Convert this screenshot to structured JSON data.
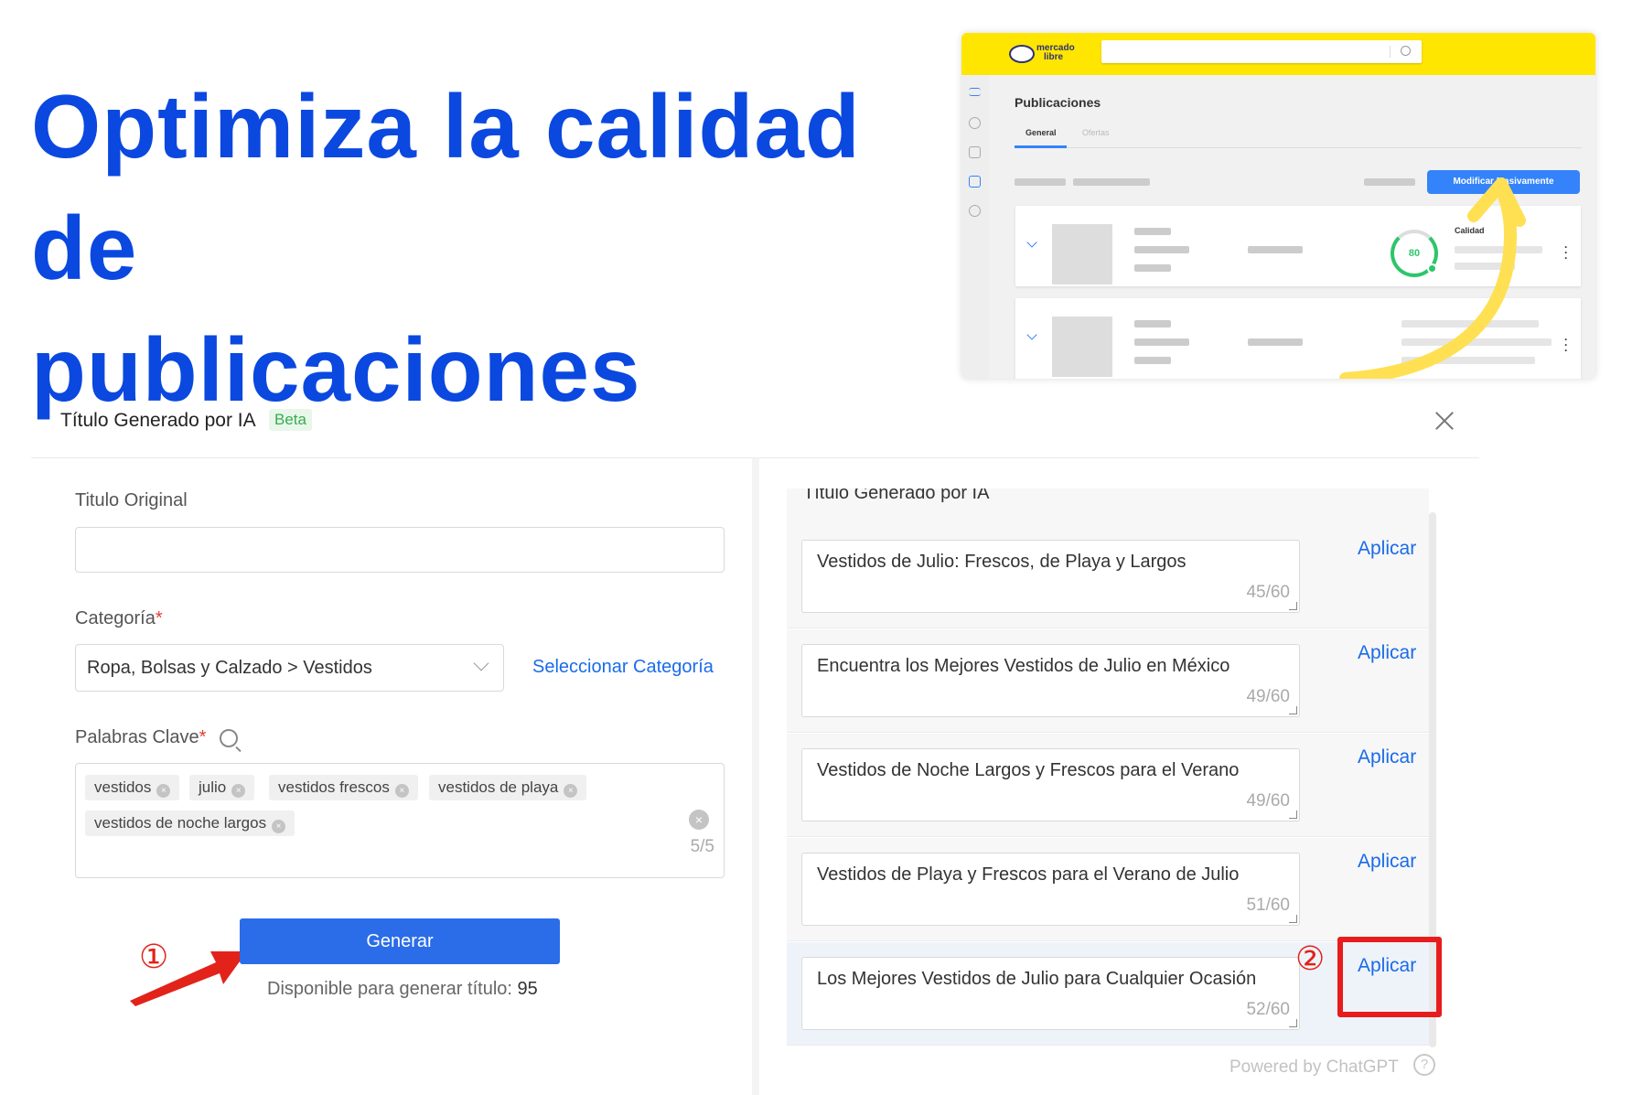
{
  "headline": {
    "line1": "Optimiza la calidad de",
    "line2": "publicaciones"
  },
  "mercadolibre": {
    "logo_text_1": "mercado",
    "logo_text_2": "libre",
    "page_title": "Publicaciones",
    "tabs": [
      {
        "label": "General"
      },
      {
        "label": "Ofertas"
      }
    ],
    "bulk_button": "Modificar Masivamente",
    "quality_score": "80",
    "quality_label": "Calidad",
    "accent": "#3483fa",
    "brand_yellow": "#ffe600"
  },
  "dialog": {
    "title": "Título Generado por IA",
    "badge": "Beta",
    "original_title_label": "Titulo Original",
    "original_title_value": "",
    "category_label": "Categoría",
    "category_value": "Ropa, Bolsas y Calzado > Vestidos",
    "select_category_link": "Seleccionar Categoría",
    "keywords_label": "Palabras Clave",
    "required_mark": "*",
    "keywords": [
      "vestidos",
      "julio",
      "vestidos frescos",
      "vestidos de playa",
      "vestidos de noche largos"
    ],
    "keywords_count": "5/5",
    "generate_button": "Generar",
    "available_label": "Disponible para generar título:",
    "available_count": "95",
    "results_header": "Título Generado por IA",
    "suggestions": [
      {
        "title": "Vestidos de Julio: Frescos, de Playa y Largos",
        "count": "45/60",
        "apply": "Aplicar"
      },
      {
        "title": "Encuentra los Mejores Vestidos de Julio en México",
        "count": "49/60",
        "apply": "Aplicar"
      },
      {
        "title": "Vestidos de Noche Largos y Frescos para el Verano",
        "count": "49/60",
        "apply": "Aplicar"
      },
      {
        "title": "Vestidos de Playa y Frescos para el Verano de Julio",
        "count": "51/60",
        "apply": "Aplicar"
      },
      {
        "title": "Los Mejores Vestidos de Julio para Cualquier Ocasión",
        "count": "52/60",
        "apply": "Aplicar"
      }
    ],
    "powered_by": "Powered by ChatGPT",
    "help_icon": "?"
  },
  "annotations": {
    "step1": "①",
    "step2": "②",
    "highlight_color": "#e81c1c"
  }
}
